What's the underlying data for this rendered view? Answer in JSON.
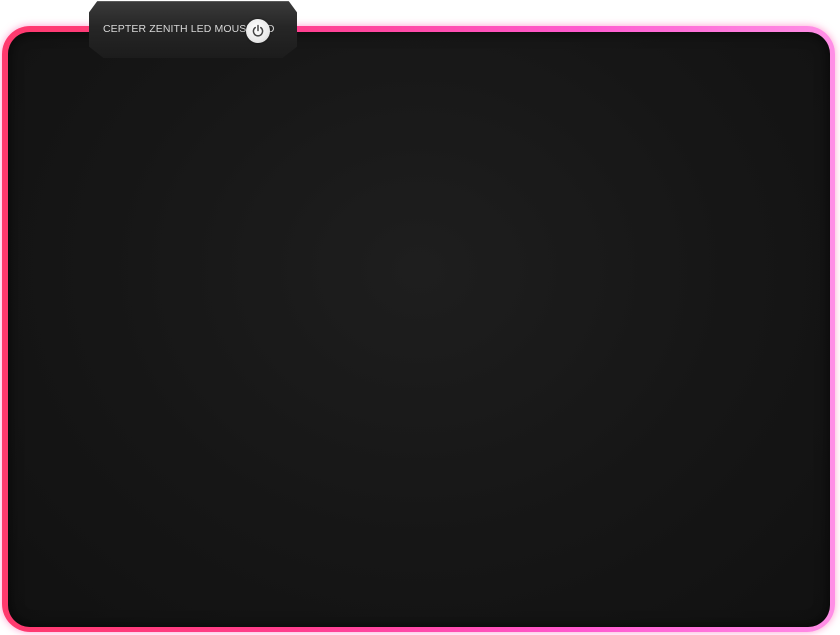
{
  "product": {
    "label": "CEPTER ZENITH LED MOUSEPAD",
    "power_icon": "power-icon"
  },
  "colors": {
    "surface": "#151515",
    "glow_left": "#ff3a6e",
    "glow_right": "#ff8fe6",
    "control_box": "#262626",
    "label_text": "#d8d8d8",
    "power_button": "#eeeeee"
  }
}
